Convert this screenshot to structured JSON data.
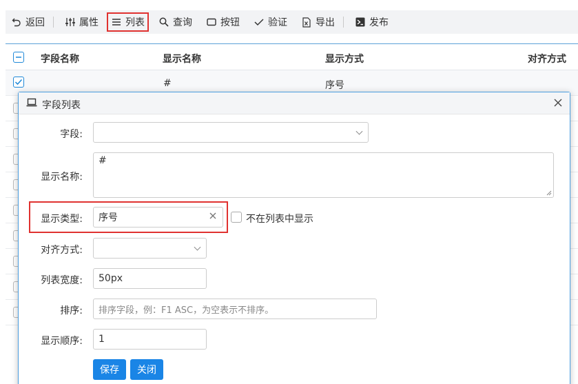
{
  "toolbar": {
    "back": "返回",
    "properties": "属性",
    "list": "列表",
    "query": "查询",
    "buttons": "按钮",
    "validate": "验证",
    "export": "导出",
    "publish": "发布"
  },
  "grid": {
    "columns": [
      "字段名称",
      "显示名称",
      "显示方式",
      "对齐方式"
    ],
    "row1": {
      "display_name": "#",
      "display_mode": "序号"
    }
  },
  "dialog": {
    "title": "字段列表",
    "field_label": "字段:",
    "field_value": "",
    "display_name_label": "显示名称:",
    "display_name_value": "#",
    "display_type_label": "显示类型:",
    "display_type_value": "序号",
    "hide_in_list_label": "不在列表中显示",
    "align_label": "对齐方式:",
    "align_value": "",
    "width_label": "列表宽度:",
    "width_value": "50px",
    "sort_label": "排序:",
    "sort_placeholder": "排序字段，例：F1 ASC，为空表示不排序。",
    "order_label": "显示顺序:",
    "order_value": "1",
    "save": "保存",
    "close": "关闭"
  },
  "colors": {
    "accent": "#1a85e6",
    "highlight": "#e0312f",
    "border_blue": "#4a9ee0"
  }
}
